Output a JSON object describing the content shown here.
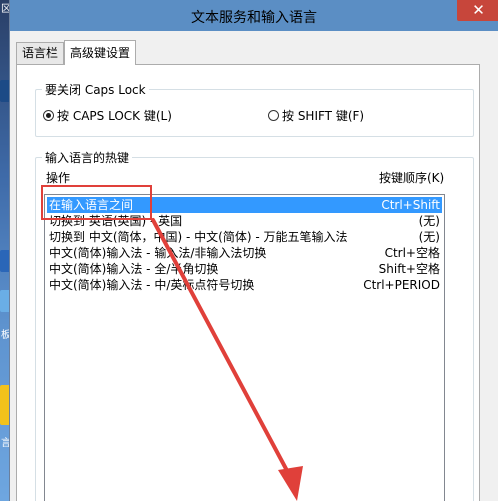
{
  "desktop": {
    "edge_glyphs": [
      "区",
      "板",
      "言"
    ]
  },
  "window": {
    "title": "文本服务和输入语言",
    "close_symbol": "✕"
  },
  "tabs": [
    {
      "label": "语言栏"
    },
    {
      "label": "高级键设置"
    }
  ],
  "caps_group": {
    "title": "要关闭 Caps Lock",
    "options": [
      {
        "label": "按 CAPS LOCK 键(L)",
        "checked": true
      },
      {
        "label": "按 SHIFT 键(F)",
        "checked": false
      }
    ]
  },
  "hotkeys_group": {
    "title": "输入语言的热键",
    "col_action": "操作",
    "col_key": "按键顺序(K)",
    "rows": [
      {
        "action": "在输入语言之间",
        "key": "Ctrl+Shift",
        "selected": true
      },
      {
        "action": "切换到 英语(英国) - 英国",
        "key": "(无)",
        "selected": false
      },
      {
        "action": "切换到 中文(简体，中国) - 中文(简体) - 万能五笔输入法",
        "key": "(无)",
        "selected": false
      },
      {
        "action": "中文(简体)输入法 - 输入法/非输入法切换",
        "key": "Ctrl+空格",
        "selected": false
      },
      {
        "action": "中文(简体)输入法 - 全/半角切换",
        "key": "Shift+空格",
        "selected": false
      },
      {
        "action": "中文(简体)输入法 - 中/英标点符号切换",
        "key": "Ctrl+PERIOD",
        "selected": false
      }
    ]
  },
  "colors": {
    "titlebar": "#5b8ec4",
    "close": "#c7463b",
    "selection": "#3399ff",
    "annotation": "#e0403a"
  }
}
